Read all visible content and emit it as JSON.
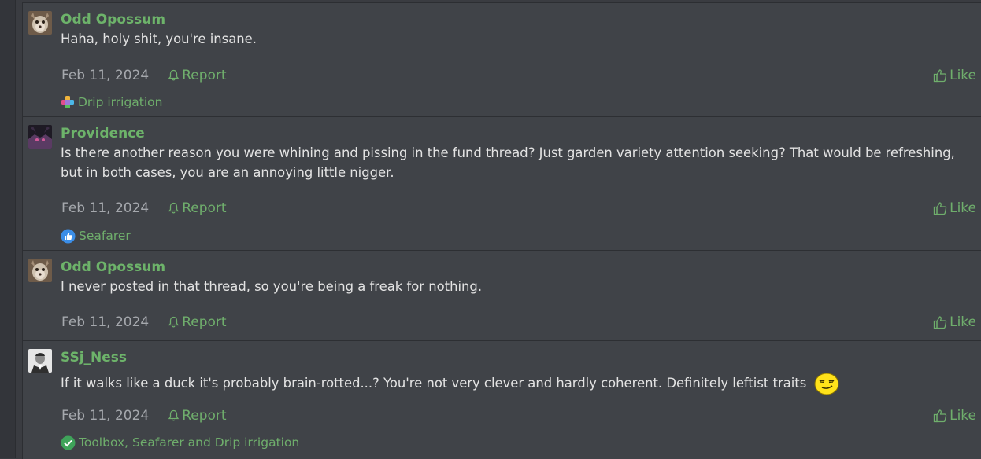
{
  "posts": [
    {
      "username": "Odd Opossum",
      "message": "Haha, holy shit, you're insane.",
      "date": "Feb 11, 2024",
      "report": "Report",
      "like": "Like",
      "reactions": "Drip irrigation",
      "reaction_icon": "puzzle-reaction-icon"
    },
    {
      "username": "Providence",
      "message": "Is there another reason you were whining and pissing in the fund thread? Just garden variety attention seeking? That would be refreshing, but in both cases, you are an annoying little nigger.",
      "date": "Feb 11, 2024",
      "report": "Report",
      "like": "Like",
      "reactions": "Seafarer",
      "reaction_icon": "thumbs-up-reaction-icon"
    },
    {
      "username": "Odd Opossum",
      "message": "I never posted in that thread, so you're being a freak for nothing.",
      "date": "Feb 11, 2024",
      "report": "Report",
      "like": "Like"
    },
    {
      "username": "SSj_Ness",
      "message": "If it walks like a duck it's probably brain-rotted...? You're not very clever and hardly coherent. Definitely leftist traits",
      "emoji": "smug-smiley-emoji",
      "date": "Feb 11, 2024",
      "report": "Report",
      "like": "Like",
      "reactions": "Toolbox, Seafarer and Drip irrigation",
      "reaction_icon": "check-reaction-icon"
    }
  ],
  "colors": {
    "username": "#6db36a",
    "link": "#6fae6c",
    "text": "#e3e3e3",
    "muted": "#a5a8ad",
    "panel": "#404348",
    "background": "#3a3c41"
  }
}
